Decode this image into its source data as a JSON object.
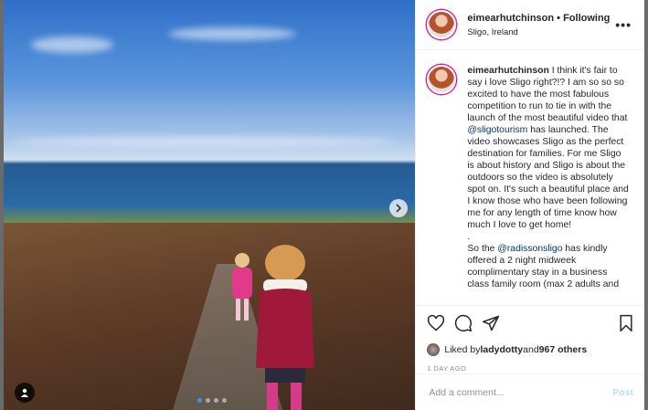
{
  "colors": {
    "accent": "#3897f0",
    "mention": "#00376b",
    "post_button": "#b2dffc",
    "story_ring": "#d6249f"
  },
  "media": {
    "carousel": {
      "total": 4,
      "active": 1
    },
    "next_icon": "chevron-right-icon",
    "tag_icon": "user-tag-icon"
  },
  "header": {
    "username": "eimearhutchinson",
    "separator": " • ",
    "follow_state": "Following",
    "location": "Sligo, Ireland",
    "more_glyph": "•••"
  },
  "caption": {
    "username": "eimearhutchinson",
    "text_1": " I think it's fair to say i love Sligo right?!? I am so so so excited to have the most fabulous competition to run to tie in with the launch of the most beautiful video that ",
    "mention_1": "@sligotourism",
    "text_2": " has launched. The video showcases Sligo as the perfect destination for families. For me Sligo is about history and Sligo is about the outdoors so the video is absolutely spot on. It's such a beautiful place and I know those who have been following me for any length of time know how much I love to get home!",
    "dot_line": ".",
    "text_3": "So the ",
    "mention_2": "@radissonsligo",
    "text_4": " has kindly offered a 2 night midweek complimentary stay in a business class family room (max 2 adults and"
  },
  "actions": {
    "like_icon": "heart-icon",
    "comment_icon": "comment-icon",
    "share_icon": "share-icon",
    "save_icon": "bookmark-icon"
  },
  "likes": {
    "prefix": "Liked by ",
    "user": "ladydotty",
    "middle": " and ",
    "others": "967 others"
  },
  "date": "1 DAY AGO",
  "comment": {
    "placeholder": "Add a comment...",
    "post_label": "Post"
  }
}
